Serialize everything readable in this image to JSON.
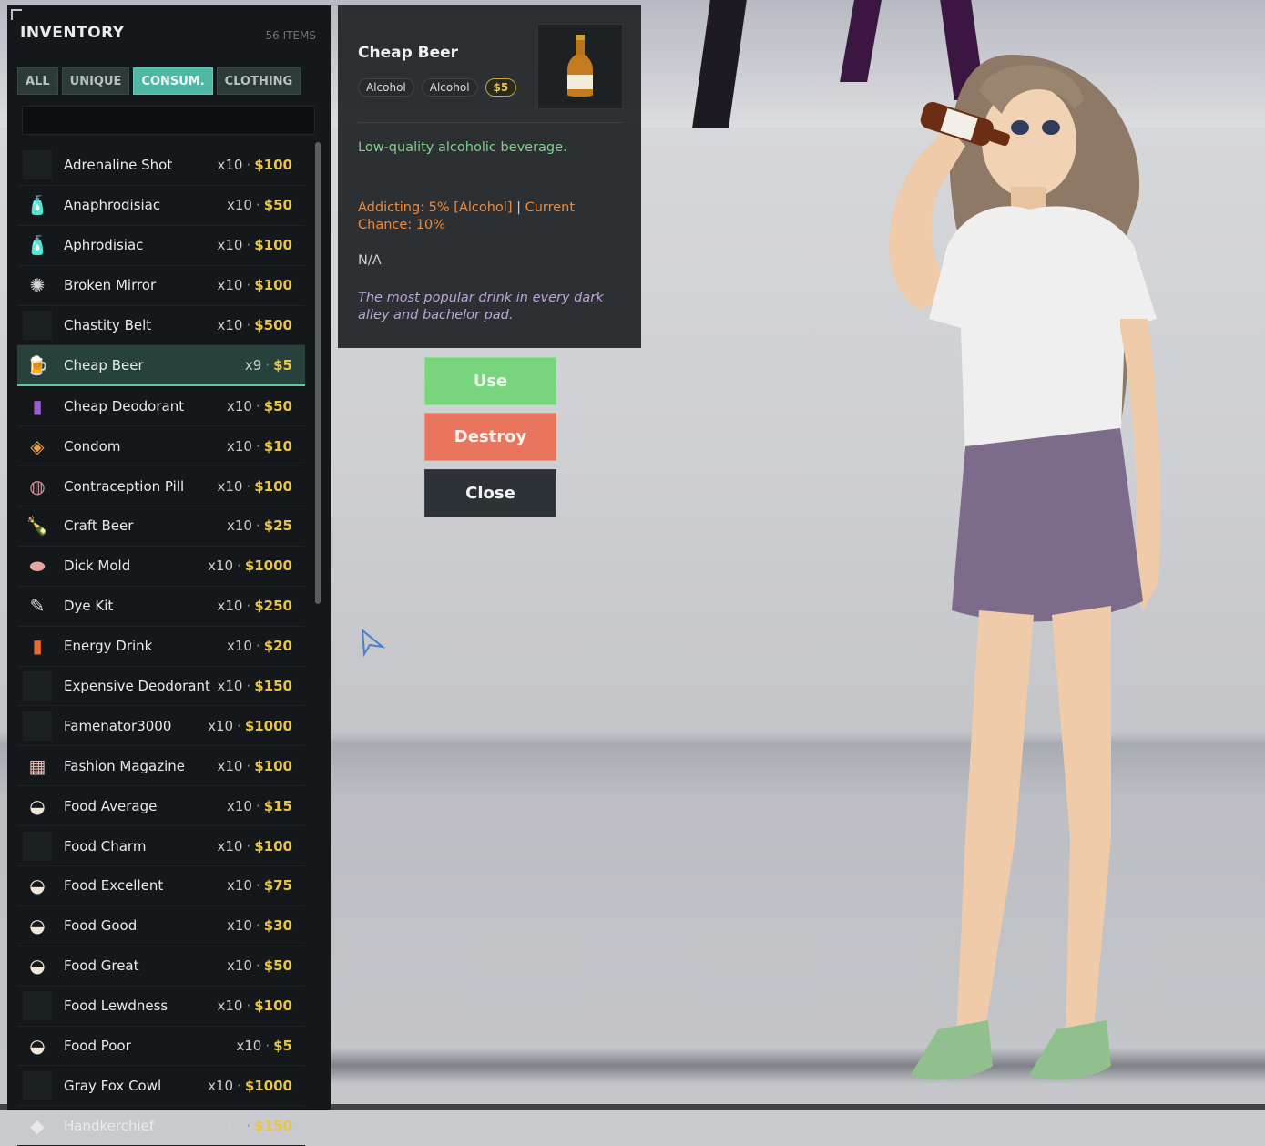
{
  "inventory": {
    "title": "INVENTORY",
    "count": "56 ITEMS",
    "tabs": [
      {
        "label": "ALL",
        "active": false
      },
      {
        "label": "UNIQUE",
        "active": false
      },
      {
        "label": "CONSUM.",
        "active": true
      },
      {
        "label": "CLOTHING",
        "active": false
      }
    ],
    "search_value": "",
    "items": [
      {
        "name": "Adrenaline Shot",
        "qty": "x10",
        "price": "$100",
        "icon": "blank"
      },
      {
        "name": "Anaphrodisiac",
        "qty": "x10",
        "price": "$50",
        "icon": "potion-icon"
      },
      {
        "name": "Aphrodisiac",
        "qty": "x10",
        "price": "$100",
        "icon": "potion-icon"
      },
      {
        "name": "Broken Mirror",
        "qty": "x10",
        "price": "$100",
        "icon": "mirror-icon"
      },
      {
        "name": "Chastity Belt",
        "qty": "x10",
        "price": "$500",
        "icon": "blank"
      },
      {
        "name": "Cheap Beer",
        "qty": "x9",
        "price": "$5",
        "icon": "beer-icon",
        "selected": true
      },
      {
        "name": "Cheap Deodorant",
        "qty": "x10",
        "price": "$50",
        "icon": "deodorant-icon"
      },
      {
        "name": "Condom",
        "qty": "x10",
        "price": "$10",
        "icon": "condom-icon"
      },
      {
        "name": "Contraception Pill",
        "qty": "x10",
        "price": "$100",
        "icon": "pill-icon"
      },
      {
        "name": "Craft Beer",
        "qty": "x10",
        "price": "$25",
        "icon": "bottle-icon"
      },
      {
        "name": "Dick Mold",
        "qty": "x10",
        "price": "$1000",
        "icon": "mold-icon"
      },
      {
        "name": "Dye Kit",
        "qty": "x10",
        "price": "$250",
        "icon": "brush-icon"
      },
      {
        "name": "Energy Drink",
        "qty": "x10",
        "price": "$20",
        "icon": "can-icon"
      },
      {
        "name": "Expensive Deodorant",
        "qty": "x10",
        "price": "$150",
        "icon": "blank"
      },
      {
        "name": "Famenator3000",
        "qty": "x10",
        "price": "$1000",
        "icon": "blank"
      },
      {
        "name": "Fashion Magazine",
        "qty": "x10",
        "price": "$100",
        "icon": "magazine-icon"
      },
      {
        "name": "Food Average",
        "qty": "x10",
        "price": "$15",
        "icon": "food-icon"
      },
      {
        "name": "Food Charm",
        "qty": "x10",
        "price": "$100",
        "icon": "blank"
      },
      {
        "name": "Food Excellent",
        "qty": "x10",
        "price": "$75",
        "icon": "food-icon"
      },
      {
        "name": "Food Good",
        "qty": "x10",
        "price": "$30",
        "icon": "food-icon"
      },
      {
        "name": "Food Great",
        "qty": "x10",
        "price": "$50",
        "icon": "food-icon"
      },
      {
        "name": "Food Lewdness",
        "qty": "x10",
        "price": "$100",
        "icon": "blank"
      },
      {
        "name": "Food Poor",
        "qty": "x10",
        "price": "$5",
        "icon": "food-icon"
      },
      {
        "name": "Gray Fox Cowl",
        "qty": "x10",
        "price": "$1000",
        "icon": "blank"
      },
      {
        "name": "Handkerchief",
        "qty": "x10",
        "price": "$150",
        "icon": "cloth-icon"
      }
    ]
  },
  "detail": {
    "title": "Cheap Beer",
    "tags": [
      "Alcohol",
      "Alcohol"
    ],
    "price": "$5",
    "description": "Low-quality alcoholic beverage.",
    "addict_part1": "Addicting: 5% [Alcohol]",
    "addict_sep": "|",
    "addict_part2": "Current Chance: 10%",
    "na": "N/A",
    "flavor": "The most popular drink in every dark alley and bachelor pad."
  },
  "actions": {
    "use": "Use",
    "destroy": "Destroy",
    "close": "Close"
  },
  "colors": {
    "accent": "#4fb8a4",
    "price": "#e8c547",
    "use": "#79d47e",
    "destroy": "#e8765f",
    "description": "#7fcf8a",
    "addict": "#ea8a3e",
    "flavor": "#b9a6d8"
  }
}
